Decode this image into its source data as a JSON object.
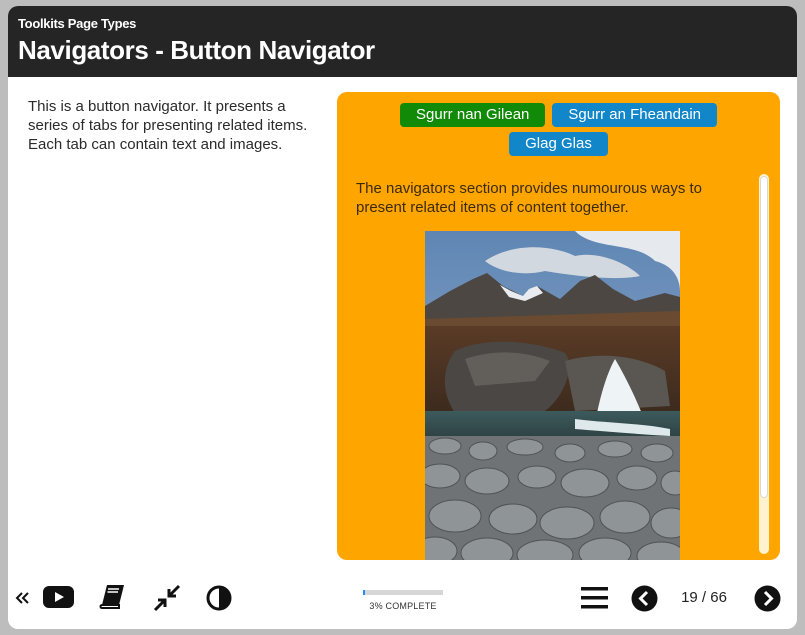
{
  "header": {
    "subtitle": "Toolkits Page Types",
    "title": "Navigators - Button Navigator"
  },
  "intro": {
    "text": "This is a button navigator. It presents a series of tabs for presenting related items. Each tab can contain text and images."
  },
  "navigator": {
    "tabs": [
      {
        "label": "Sgurr nan Gilean",
        "active": true
      },
      {
        "label": "Sgurr an Fheandain",
        "active": false
      },
      {
        "label": "Glag Glas",
        "active": false
      }
    ],
    "content_text": "The navigators section provides numourous ways to present related items of content together.",
    "image_icon": "mountain-waterfall-photo"
  },
  "footer": {
    "icons": [
      "back-chevrons-icon",
      "play-video-icon",
      "book-icon",
      "collapse-arrows-icon",
      "contrast-icon",
      "menu-icon",
      "previous-icon",
      "next-icon"
    ],
    "progress_fraction": 0.03,
    "progress_label": "3% COMPLETE",
    "page_label": "19 / 66"
  },
  "colors": {
    "header_bg": "#252525",
    "panel_bg": "#ffa500",
    "active_tab": "#118a07",
    "inactive_tab": "#1186c9",
    "progress": "#1e90ff"
  }
}
